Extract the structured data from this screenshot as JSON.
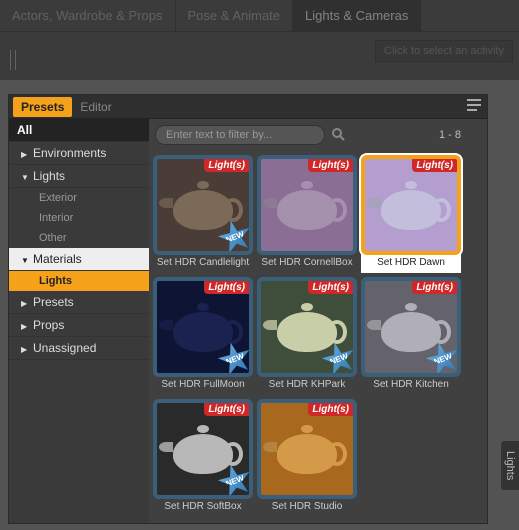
{
  "top_tabs": {
    "actors": "Actors, Wardrobe & Props",
    "pose": "Pose & Animate",
    "lights_cameras": "Lights & Cameras"
  },
  "activity_prompt": "Click to select an activity",
  "panel_tabs": {
    "presets": "Presets",
    "editor": "Editor"
  },
  "sidebar": {
    "all": "All",
    "environments": "Environments",
    "lights": "Lights",
    "lights_children": {
      "exterior": "Exterior",
      "interior": "Interior",
      "other": "Other"
    },
    "materials": "Materials",
    "materials_children": {
      "lights": "Lights"
    },
    "presets": "Presets",
    "props": "Props",
    "unassigned": "Unassigned"
  },
  "filter": {
    "placeholder": "Enter text to filter by...",
    "value": ""
  },
  "pagination": "1 - 8",
  "badge_text": "Light(s)",
  "presets": [
    {
      "label": "Set HDR Candlelight",
      "bg": "#4a3c36",
      "teapot": "#7b6a58",
      "new": true,
      "selected": false
    },
    {
      "label": "Set HDR CornellBox",
      "bg": "#8a6e94",
      "teapot": "#a590ae",
      "new": false,
      "selected": false
    },
    {
      "label": "Set HDR Dawn",
      "bg": "#b49ecf",
      "teapot": "#c4bedd",
      "new": false,
      "selected": true
    },
    {
      "label": "Set HDR FullMoon",
      "bg": "#0e1433",
      "teapot": "#1a2250",
      "new": true,
      "selected": false
    },
    {
      "label": "Set HDR KHPark",
      "bg": "#3e4e3a",
      "teapot": "#c8cfa8",
      "new": true,
      "selected": false
    },
    {
      "label": "Set HDR Kitchen",
      "bg": "#64626a",
      "teapot": "#b0aeb6",
      "new": true,
      "selected": false
    },
    {
      "label": "Set HDR SoftBox",
      "bg": "#2a2a2a",
      "teapot": "#b8b8b8",
      "new": true,
      "selected": false
    },
    {
      "label": "Set HDR Studio",
      "bg": "#a8691e",
      "teapot": "#d49a4a",
      "new": false,
      "selected": false
    }
  ],
  "vtab": "Lights"
}
